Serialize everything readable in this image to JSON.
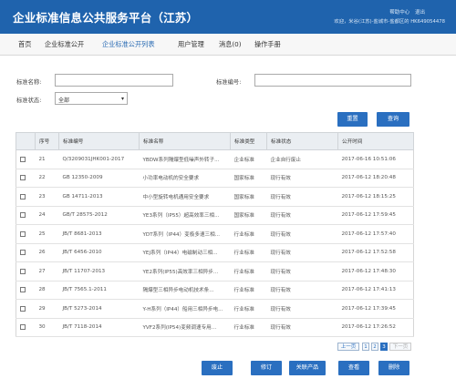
{
  "header": {
    "title": "企业标准信息公共服务平台（江苏）",
    "help_link": "帮助中心",
    "logout_link": "退出",
    "welcome_text": "欢迎，米谷(江苏)-盐城市-盐都区的 HK649054478"
  },
  "nav": {
    "items": [
      "首页",
      "企业标准公开",
      "企业标准公开列表",
      "用户管理",
      "消息(0)",
      "操作手册"
    ],
    "active_index": 2
  },
  "filters": {
    "name_label": "标准名称:",
    "number_label": "标准编号:",
    "status_label": "标准状态:",
    "status_value": "全部",
    "reset_button": "重置",
    "search_button": "查询"
  },
  "table": {
    "columns": [
      "",
      "序号",
      "标准编号",
      "标准名称",
      "标准类型",
      "标准状态",
      "公开时间"
    ],
    "rows": [
      {
        "no": "21",
        "code": "Q/3209031JHK001-2017",
        "name": "YBDW系列隔爆型低噪声外转子...",
        "type": "企业标准",
        "status": "企业自行废止",
        "time": "2017-06-16 10:51:06"
      },
      {
        "no": "22",
        "code": "GB 12350-2009",
        "name": "小功率电动机的安全要求",
        "type": "国家标准",
        "status": "现行有效",
        "time": "2017-06-12 18:20:48"
      },
      {
        "no": "23",
        "code": "GB 14711-2013",
        "name": "中小型旋转电机通用安全要求",
        "type": "国家标准",
        "status": "现行有效",
        "time": "2017-06-12 18:15:25"
      },
      {
        "no": "24",
        "code": "GB/T 28575-2012",
        "name": "YE3系列（IP55）超高效率三相...",
        "type": "国家标准",
        "status": "现行有效",
        "time": "2017-06-12 17:59:45"
      },
      {
        "no": "25",
        "code": "JB/T 8681-2013",
        "name": "YDT系列（IP44）变极多速三相...",
        "type": "行业标准",
        "status": "现行有效",
        "time": "2017-06-12 17:57:40"
      },
      {
        "no": "26",
        "code": "JB/T 6456-2010",
        "name": "YEJ系列（IP44）电磁制动三相...",
        "type": "行业标准",
        "status": "现行有效",
        "time": "2017-06-12 17:52:58"
      },
      {
        "no": "27",
        "code": "JB/T 11707-2013",
        "name": "YE2系列(IP55)高效率三相异步...",
        "type": "行业标准",
        "status": "现行有效",
        "time": "2017-06-12 17:48:30"
      },
      {
        "no": "28",
        "code": "JB/T 7565.1-2011",
        "name": "隔爆型三相异步电动机技术条...",
        "type": "行业标准",
        "status": "现行有效",
        "time": "2017-06-12 17:41:13"
      },
      {
        "no": "29",
        "code": "JB/T 5273-2014",
        "name": "Y-H系列（IP44）船用三相异步电...",
        "type": "行业标准",
        "status": "现行有效",
        "time": "2017-06-12 17:39:45"
      },
      {
        "no": "30",
        "code": "JB/T 7118-2014",
        "name": "YVF2系列(IP54)变频调速专用...",
        "type": "行业标准",
        "status": "现行有效",
        "time": "2017-06-12 17:26:52"
      }
    ]
  },
  "pagination": {
    "prev_label": "上一页",
    "pages": [
      "1",
      "2",
      "3"
    ],
    "current_page": "3",
    "next_label": "下一页"
  },
  "actions": {
    "abolish_button": "废止",
    "revise_button": "修订",
    "link_product_button": "关联产品",
    "view_button": "查看",
    "delete_button": "删除"
  },
  "colors": {
    "primary": "#1f63ad",
    "button": "#2a6fc0",
    "active_nav": "#2b6cb4"
  }
}
